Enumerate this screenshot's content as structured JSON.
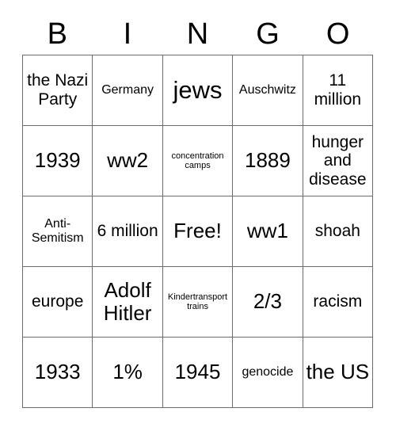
{
  "card": {
    "title": "BINGO",
    "header_letters": [
      "B",
      "I",
      "N",
      "G",
      "O"
    ],
    "grid": [
      [
        {
          "text": "the Nazi Party",
          "size": "md"
        },
        {
          "text": "Germany",
          "size": "sm"
        },
        {
          "text": "jews",
          "size": "xl"
        },
        {
          "text": "Auschwitz",
          "size": "sm"
        },
        {
          "text": "11 million",
          "size": "md"
        }
      ],
      [
        {
          "text": "1939",
          "size": "lg"
        },
        {
          "text": "ww2",
          "size": "lg"
        },
        {
          "text": "concentration camps",
          "size": "xs"
        },
        {
          "text": "1889",
          "size": "lg"
        },
        {
          "text": "hunger and disease",
          "size": "md"
        }
      ],
      [
        {
          "text": "Anti-Semitism",
          "size": "sm"
        },
        {
          "text": "6 million",
          "size": "md"
        },
        {
          "text": "Free!",
          "size": "lg"
        },
        {
          "text": "ww1",
          "size": "lg"
        },
        {
          "text": "shoah",
          "size": "md"
        }
      ],
      [
        {
          "text": "europe",
          "size": "md"
        },
        {
          "text": "Adolf Hitler",
          "size": "lg"
        },
        {
          "text": "Kindertransport trains",
          "size": "xs"
        },
        {
          "text": "2/3",
          "size": "lg"
        },
        {
          "text": "racism",
          "size": "md"
        }
      ],
      [
        {
          "text": "1933",
          "size": "lg"
        },
        {
          "text": "1%",
          "size": "lg"
        },
        {
          "text": "1945",
          "size": "lg"
        },
        {
          "text": "genocide",
          "size": "sm"
        },
        {
          "text": "the US",
          "size": "lg"
        }
      ]
    ],
    "colors": {
      "background": "#ffffff",
      "text": "#000000",
      "grid_line": "#6b6b6b"
    }
  }
}
